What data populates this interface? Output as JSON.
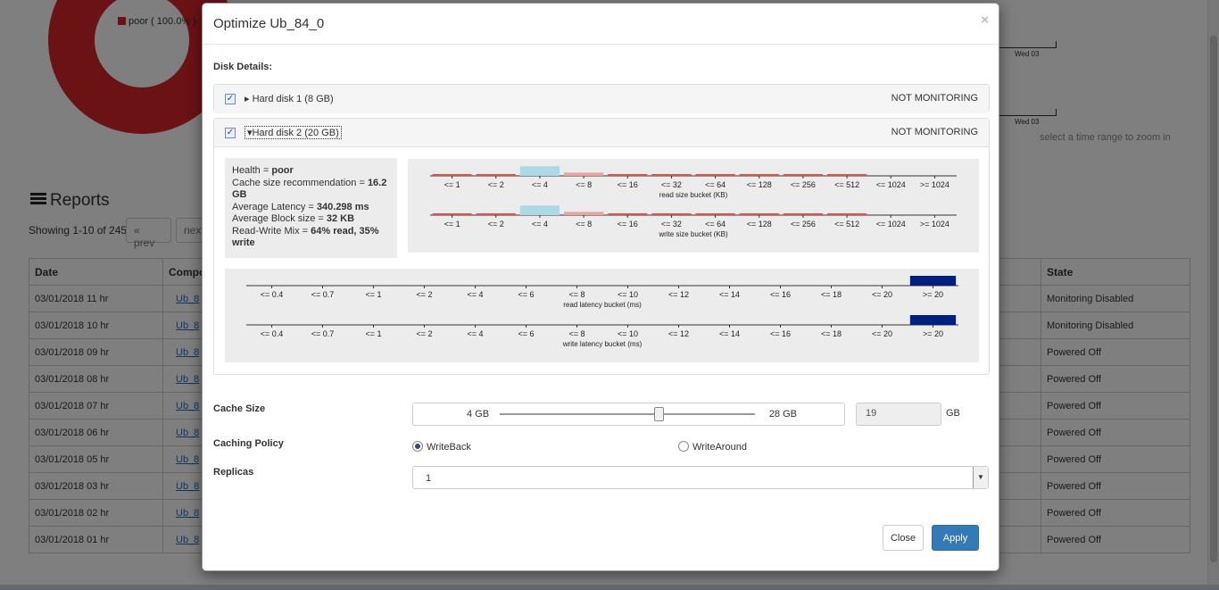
{
  "background": {
    "legend_label": "poor ( 100.0% )",
    "timeline_label_1": "Wed 03",
    "timeline_label_2": "Wed 03",
    "zoom_hint": "select a time range to zoom in",
    "reports_title": "Reports",
    "showing_text": "Showing 1-10 of 245.",
    "prev_label": "« prev",
    "next_label": "next",
    "table": {
      "headers": [
        "Date",
        "Compo",
        "State"
      ],
      "rows": [
        {
          "date": "03/01/2018 11 hr",
          "component": "Ub_8",
          "state": "Monitoring Disabled"
        },
        {
          "date": "03/01/2018 10 hr",
          "component": "Ub_8",
          "state": "Monitoring Disabled"
        },
        {
          "date": "03/01/2018 09 hr",
          "component": "Ub_8",
          "state": "Powered Off"
        },
        {
          "date": "03/01/2018 08 hr",
          "component": "Ub_8",
          "state": "Powered Off"
        },
        {
          "date": "03/01/2018 07 hr",
          "component": "Ub_8",
          "state": "Powered Off"
        },
        {
          "date": "03/01/2018 06 hr",
          "component": "Ub_8",
          "state": "Powered Off"
        },
        {
          "date": "03/01/2018 05 hr",
          "component": "Ub_8",
          "state": "Powered Off"
        },
        {
          "date": "03/01/2018 03 hr",
          "component": "Ub_8",
          "state": "Powered Off"
        },
        {
          "date": "03/01/2018 02 hr",
          "component": "Ub_8",
          "state": "Powered Off"
        },
        {
          "date": "03/01/2018 01 hr",
          "component": "Ub_8",
          "state": "Powered Off"
        }
      ]
    }
  },
  "modal": {
    "title": "Optimize Ub_84_0",
    "close_glyph": "×",
    "disk_details_label": "Disk Details:",
    "disks": [
      {
        "name": "Hard disk 1 (8 GB)",
        "status": "NOT MONITORING",
        "checked": true,
        "expanded": false
      },
      {
        "name": "Hard disk 2 (20 GB)",
        "status": "NOT MONITORING",
        "checked": true,
        "expanded": true
      }
    ],
    "health": {
      "health_prefix": "Health = ",
      "health_value": "poor",
      "cache_prefix": "Cache size recommendation = ",
      "cache_value": "16.2 GB",
      "latency_prefix": "Average Latency = ",
      "latency_value": "340.298 ms",
      "block_prefix": "Average Block size = ",
      "block_value": "32 KB",
      "mix_prefix": "Read-Write Mix = ",
      "mix_value": "64% read, 35% write"
    },
    "cache_size": {
      "label": "Cache Size",
      "min_label": "4 GB",
      "max_label": "28 GB",
      "min": 4,
      "max": 28,
      "value": 19,
      "value_text": "19",
      "unit": "GB"
    },
    "caching_policy": {
      "label": "Caching Policy",
      "options": [
        "WriteBack",
        "WriteAround"
      ],
      "selected": "WriteBack"
    },
    "replicas": {
      "label": "Replicas",
      "value": "1"
    },
    "buttons": {
      "close": "Close",
      "apply": "Apply"
    }
  },
  "colors": {
    "poor_red": "#d6242b",
    "hist_light_red": "#e8a49f",
    "hist_red": "#d9534f",
    "hist_light_blue": "#add8e6",
    "hist_navy": "#00207f",
    "apply_blue": "#337ab7"
  },
  "chart_data": [
    {
      "type": "bar",
      "xlabel": "read size bucket (KB)",
      "categories": [
        "<= 1",
        "<= 2",
        "<= 4",
        "<= 8",
        "<= 16",
        "<= 32",
        "<= 64",
        "<= 128",
        "<= 256",
        "<= 512",
        "<= 1024",
        ">= 1024"
      ],
      "values": [
        0.1,
        0.05,
        0.9,
        0.3,
        0.05,
        0.03,
        0.02,
        0.01,
        0.01,
        0.04,
        0,
        0
      ],
      "colors": [
        "#d9534f",
        "#d9534f",
        "#add8e6",
        "#e8a49f",
        "#d9534f",
        "#d9534f",
        "#d9534f",
        "#d9534f",
        "#d9534f",
        "#d9534f",
        "#d9534f",
        "#d9534f"
      ]
    },
    {
      "type": "bar",
      "xlabel": "write size bucket (KB)",
      "categories": [
        "<= 1",
        "<= 2",
        "<= 4",
        "<= 8",
        "<= 16",
        "<= 32",
        "<= 64",
        "<= 128",
        "<= 256",
        "<= 512",
        "<= 1024",
        ">= 1024"
      ],
      "values": [
        0.1,
        0.05,
        0.9,
        0.3,
        0.05,
        0.03,
        0.02,
        0.01,
        0.01,
        0.04,
        0,
        0
      ],
      "colors": [
        "#d9534f",
        "#d9534f",
        "#add8e6",
        "#e8a49f",
        "#d9534f",
        "#d9534f",
        "#d9534f",
        "#d9534f",
        "#d9534f",
        "#d9534f",
        "#d9534f",
        "#d9534f"
      ]
    },
    {
      "type": "bar",
      "xlabel": "read latency bucket (ms)",
      "categories": [
        "<= 0.4",
        "<= 0.7",
        "<= 1",
        "<= 2",
        "<= 4",
        "<= 6",
        "<= 8",
        "<= 10",
        "<= 12",
        "<= 14",
        "<= 16",
        "<= 18",
        "<= 20",
        ">= 20"
      ],
      "values": [
        0,
        0,
        0,
        0,
        0,
        0,
        0,
        0,
        0,
        0,
        0,
        0,
        0,
        1
      ],
      "colors": [
        "#00207f",
        "#00207f",
        "#00207f",
        "#00207f",
        "#00207f",
        "#00207f",
        "#00207f",
        "#00207f",
        "#00207f",
        "#00207f",
        "#00207f",
        "#00207f",
        "#00207f",
        "#00207f"
      ]
    },
    {
      "type": "bar",
      "xlabel": "write latency bucket (ms)",
      "categories": [
        "<= 0.4",
        "<= 0.7",
        "<= 1",
        "<= 2",
        "<= 4",
        "<= 6",
        "<= 8",
        "<= 10",
        "<= 12",
        "<= 14",
        "<= 16",
        "<= 18",
        "<= 20",
        ">= 20"
      ],
      "values": [
        0,
        0,
        0,
        0,
        0,
        0,
        0,
        0,
        0,
        0,
        0,
        0,
        0,
        1
      ],
      "colors": [
        "#00207f",
        "#00207f",
        "#00207f",
        "#00207f",
        "#00207f",
        "#00207f",
        "#00207f",
        "#00207f",
        "#00207f",
        "#00207f",
        "#00207f",
        "#00207f",
        "#00207f",
        "#00207f"
      ]
    }
  ]
}
